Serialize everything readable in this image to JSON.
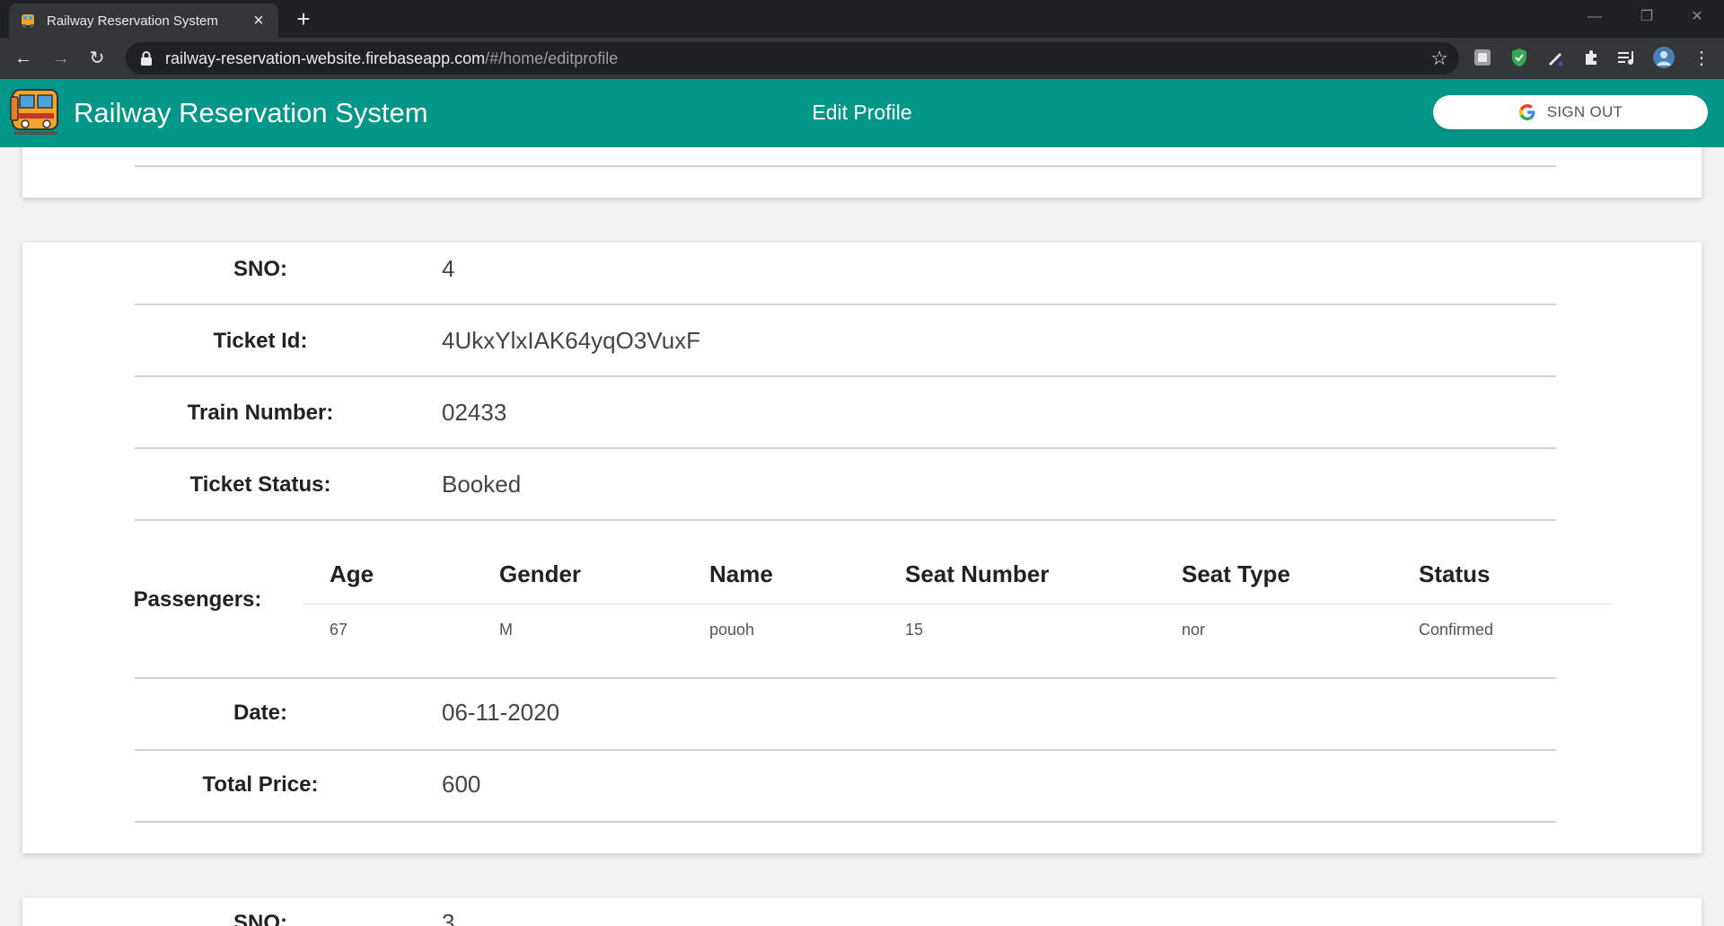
{
  "browser": {
    "tab_title": "Railway Reservation System",
    "url_host": "railway-reservation-website.firebaseapp.com",
    "url_path": "/#/home/editprofile"
  },
  "header": {
    "app_title": "Railway Reservation System",
    "page_heading": "Edit Profile",
    "signout_label": "SIGN OUT"
  },
  "ticket": {
    "sno_label": "SNO:",
    "sno": "4",
    "ticket_id_label": "Ticket Id:",
    "ticket_id": "4UkxYlxIAK64yqO3VuxF",
    "train_number_label": "Train Number:",
    "train_number": "02433",
    "ticket_status_label": "Ticket Status:",
    "ticket_status": "Booked",
    "passengers_label": "Passengers:",
    "passenger_columns": [
      "Age",
      "Gender",
      "Name",
      "Seat Number",
      "Seat Type",
      "Status"
    ],
    "passengers": [
      [
        "67",
        "M",
        "pouoh",
        "15",
        "nor",
        "Confirmed"
      ]
    ],
    "date_label": "Date:",
    "date": "06-11-2020",
    "total_price_label": "Total Price:",
    "total_price": "600"
  },
  "next_ticket": {
    "sno_label": "SNO:",
    "sno": "3"
  },
  "colors": {
    "header_bg": "#009688",
    "chrome_dark": "#202124",
    "chrome_toolbar": "#35363a"
  }
}
